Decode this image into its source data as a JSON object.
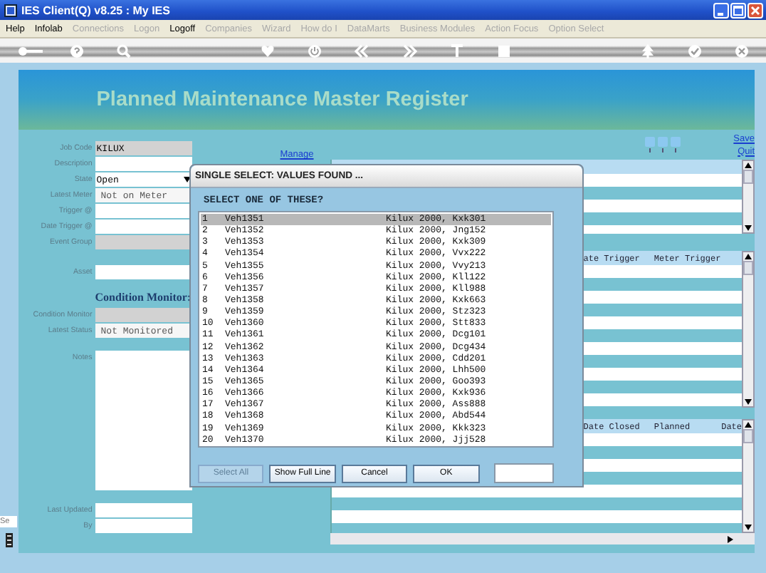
{
  "window": {
    "title": "IES Client(Q) v8.25 : My IES"
  },
  "menu": [
    {
      "label": "Help",
      "disabled": false
    },
    {
      "label": "Infolab",
      "disabled": false
    },
    {
      "label": "Connections",
      "disabled": true
    },
    {
      "label": "Logon",
      "disabled": true
    },
    {
      "label": "Logoff",
      "disabled": false
    },
    {
      "label": "Companies",
      "disabled": true
    },
    {
      "label": "Wizard",
      "disabled": true
    },
    {
      "label": "How do I",
      "disabled": true
    },
    {
      "label": "DataMarts",
      "disabled": true
    },
    {
      "label": "Business Modules",
      "disabled": true
    },
    {
      "label": "Action Focus",
      "disabled": true
    },
    {
      "label": "Option Select",
      "disabled": true
    }
  ],
  "side_strip": {
    "field_value": "Se"
  },
  "page": {
    "title": "Planned Maintenance Master Register",
    "manage_link": "Manage",
    "actions": [
      "Save",
      "Quit"
    ]
  },
  "form": {
    "sections": [
      {
        "fields": [
          {
            "label": "Job Code",
            "value": "KILUX",
            "kind": "locked"
          },
          {
            "label": "Description",
            "kind": "text"
          },
          {
            "label": "State",
            "value": "Open",
            "kind": "dropdown"
          },
          {
            "label": "Latest Meter",
            "value": "Not on Meter",
            "kind": "status"
          },
          {
            "label": "Trigger @",
            "kind": "text"
          },
          {
            "label": "Date Trigger @",
            "kind": "text"
          },
          {
            "label": "Event Group",
            "kind": "locked"
          }
        ]
      },
      {
        "fields": [
          {
            "label": "Asset",
            "kind": "text"
          }
        ]
      },
      {
        "heading": "Condition Monitor:",
        "fields": [
          {
            "label": "Condition Monitor",
            "kind": "locked"
          },
          {
            "label": "Latest Status",
            "value": "Not Monitored",
            "kind": "status"
          },
          {
            "label": "Notes",
            "kind": "notes"
          }
        ]
      },
      {
        "fields": [
          {
            "label": "Last Updated",
            "kind": "text"
          },
          {
            "label": "By",
            "kind": "text"
          }
        ]
      }
    ]
  },
  "grids": [
    {
      "columns": [
        "ate Trigger",
        "Meter Trigger"
      ]
    },
    {
      "columns": [
        "Date Closed",
        "Planned",
        "Date"
      ]
    }
  ],
  "dialog": {
    "title": "SINGLE SELECT: VALUES FOUND ...",
    "prompt": "SELECT ONE OF THESE?",
    "items": [
      {
        "number": "1",
        "code": "Veh1351",
        "description": "Kilux 2000, Kxk301",
        "selected": true
      },
      {
        "number": "2",
        "code": "Veh1352",
        "description": "Kilux 2000, Jng152",
        "selected": false
      },
      {
        "number": "3",
        "code": "Veh1353",
        "description": "Kilux 2000, Kxk309",
        "selected": false
      },
      {
        "number": "4",
        "code": "Veh1354",
        "description": "Kilux 2000, Vvx222",
        "selected": false
      },
      {
        "number": "5",
        "code": "Veh1355",
        "description": "Kilux 2000, Vvy213",
        "selected": false
      },
      {
        "number": "6",
        "code": "Veh1356",
        "description": "Kilux 2000, Kll122",
        "selected": false
      },
      {
        "number": "7",
        "code": "Veh1357",
        "description": "Kilux 2000, Kll988",
        "selected": false
      },
      {
        "number": "8",
        "code": "Veh1358",
        "description": "Kilux 2000, Kxk663",
        "selected": false
      },
      {
        "number": "9",
        "code": "Veh1359",
        "description": "Kilux 2000, Stz323",
        "selected": false
      },
      {
        "number": "10",
        "code": "Veh1360",
        "description": "Kilux 2000, Stt833",
        "selected": false
      },
      {
        "number": "11",
        "code": "Veh1361",
        "description": "Kilux 2000, Dcg101",
        "selected": false
      },
      {
        "number": "12",
        "code": "Veh1362",
        "description": "Kilux 2000, Dcg434",
        "selected": false
      },
      {
        "number": "13",
        "code": "Veh1363",
        "description": "Kilux 2000, Cdd201",
        "selected": false
      },
      {
        "number": "14",
        "code": "Veh1364",
        "description": "Kilux 2000, Lhh500",
        "selected": false
      },
      {
        "number": "15",
        "code": "Veh1365",
        "description": "Kilux 2000, Goo393",
        "selected": false
      },
      {
        "number": "16",
        "code": "Veh1366",
        "description": "Kilux 2000, Kxk936",
        "selected": false
      },
      {
        "number": "17",
        "code": "Veh1367",
        "description": "Kilux 2000, Ass888",
        "selected": false
      },
      {
        "number": "18",
        "code": "Veh1368",
        "description": "Kilux 2000, Abd544",
        "selected": false
      },
      {
        "number": "19",
        "code": "Veh1369",
        "description": "Kilux 2000, Kkk323",
        "selected": false
      },
      {
        "number": "20",
        "code": "Veh1370",
        "description": "Kilux 2000, Jjj528",
        "selected": false
      }
    ],
    "buttons": [
      {
        "label": "Select All",
        "disabled": true
      },
      {
        "label": "Show Full Line",
        "disabled": false
      },
      {
        "label": "Cancel",
        "disabled": false
      },
      {
        "label": "OK",
        "disabled": false
      }
    ]
  }
}
